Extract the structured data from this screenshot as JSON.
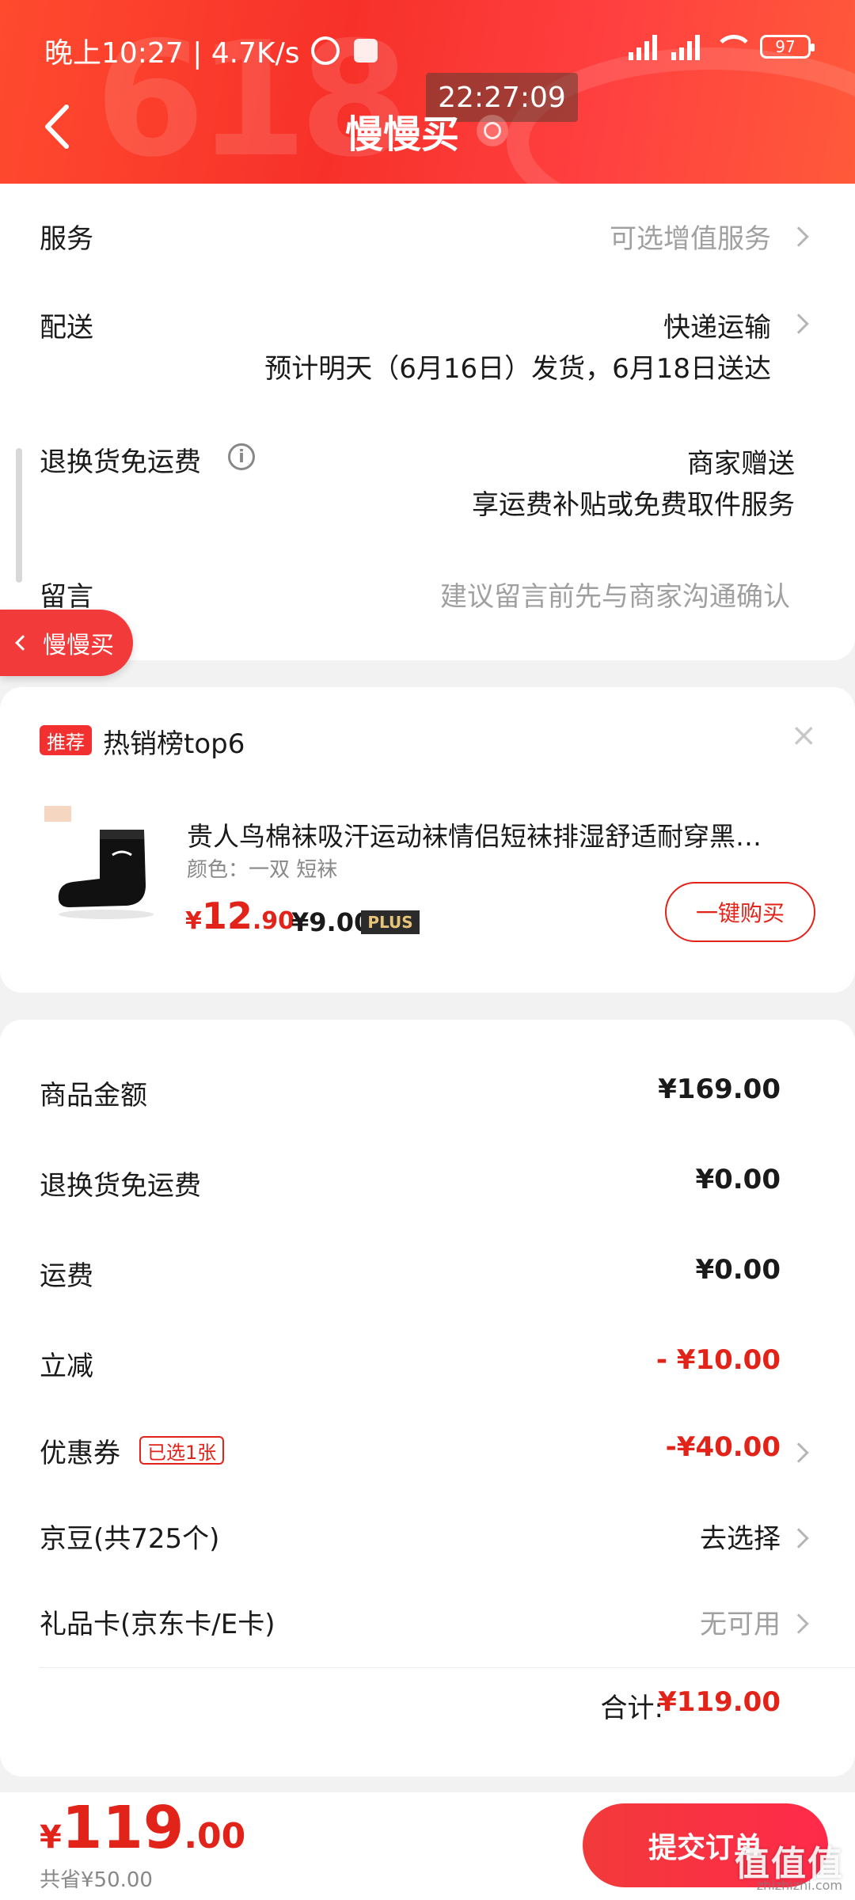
{
  "status_bar": {
    "left_text": "晚上10:27 | 4.7K/s",
    "battery": "97",
    "time_overlay": "22:27:09"
  },
  "header": {
    "title": "慢慢买",
    "bg_text": "618"
  },
  "order": {
    "service_label": "服务",
    "service_value": "可选增值服务",
    "delivery_label": "配送",
    "delivery_value": "快递运输",
    "delivery_estimate": "预计明天（6月16日）发货，6月18日送达",
    "return_label": "退换货免运费",
    "return_value": "商家赠送",
    "return_desc": "享运费补贴或免费取件服务",
    "message_label": "留言",
    "message_placeholder": "建议留言前先与商家沟通确认"
  },
  "floating_button": {
    "label": "慢慢买"
  },
  "recommend": {
    "badge": "推荐",
    "title": "热销榜top6",
    "close": "×",
    "product_name": "贵人鸟棉袜吸汗运动袜情侣短袜排湿舒适耐穿黑…",
    "product_attr": "颜色：一双 短袜",
    "price_symbol": "¥",
    "price_int": "12",
    "price_dec": ".90",
    "plus_price": "¥9.00",
    "plus_tag": "PLUS",
    "buy_label": "一键购买"
  },
  "summary": {
    "goods_label": "商品金额",
    "goods_value": "¥169.00",
    "return_label": "退换货免运费",
    "return_value": "¥0.00",
    "freight_label": "运费",
    "freight_value": "¥0.00",
    "discount_label": "立减",
    "discount_value": "- ¥10.00",
    "coupon_label": "优惠券",
    "coupon_tag": "已选1张",
    "coupon_value": "-¥40.00",
    "jingdou_label": "京豆(共725个)",
    "jingdou_value": "去选择",
    "giftcard_label": "礼品卡(京东卡/E卡)",
    "giftcard_value": "无可用",
    "total_label": "合计:",
    "total_value": "¥119.00"
  },
  "bottom": {
    "symbol": "¥",
    "int": "119",
    "dec": ".00",
    "saved": "共省¥50.00",
    "submit": "提交订单"
  },
  "watermark": {
    "main": "值值值",
    "sub": "zhizhizhi.com"
  },
  "colors": {
    "accent": "#e2231a",
    "header": "#f7312a"
  }
}
